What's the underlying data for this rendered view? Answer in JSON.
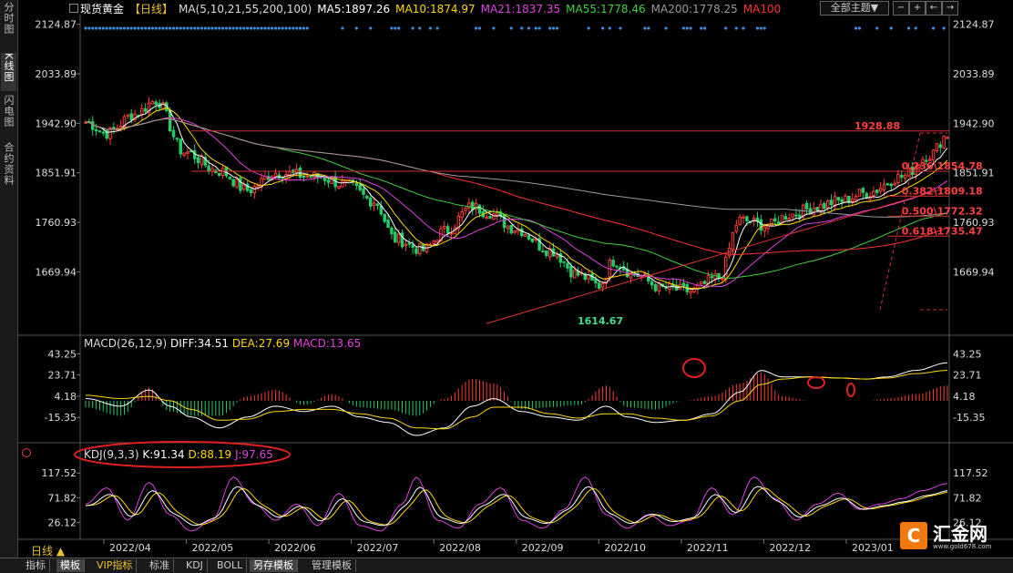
{
  "sidebar": {
    "tabs": [
      {
        "label": "分时图",
        "active": false
      },
      {
        "label": "K线图",
        "active": true
      },
      {
        "label": "闪电图",
        "active": false
      },
      {
        "label": "合约资料",
        "active": false
      }
    ]
  },
  "header": {
    "instrument": "现货黄金",
    "period": "【日线】",
    "ma_label": "MA(5,10,21,55,200,100)",
    "ma5": "MA5:1897.26",
    "ma10": "MA10:1874.97",
    "ma21": "MA21:1837.35",
    "ma55": "MA55:1778.46",
    "ma200": "MA200:1778.25",
    "ma100": "MA100",
    "theme_select": "全部主题▼"
  },
  "colors": {
    "up": "#ff3b3b",
    "down": "#22cc66",
    "ma5": "#ffffff",
    "ma10": "#ffd700",
    "ma21": "#e040e0",
    "ma55": "#40d040",
    "ma200": "#9a9a9a",
    "ma100": "#ff3030",
    "axis_text": "#dddddd",
    "annotation_red": "#ff4040",
    "low_label": "#44dd88"
  },
  "macd_title": {
    "label": "MACD(26,12,9)",
    "diff": "DIFF:34.51",
    "dea": "DEA:27.69",
    "macd": "MACD:13.65"
  },
  "kdj_title": {
    "label": "KDJ(9,3,3)",
    "k": "K:91.34",
    "d": "D:88.19",
    "j": "J:97.65"
  },
  "period_label": "日线 ▲",
  "bottom_tabs": [
    {
      "label": "指标",
      "active": false,
      "vip": false
    },
    {
      "label": "模板",
      "active": true,
      "vip": false
    },
    {
      "label": "VIP指标",
      "active": false,
      "vip": true
    },
    {
      "label": "标准",
      "active": false,
      "vip": false
    },
    {
      "label": "KDJ",
      "active": false,
      "vip": false
    },
    {
      "label": "BOLL",
      "active": false,
      "vip": false
    },
    {
      "label": "另存模板",
      "active": true,
      "vip": false
    },
    {
      "label": "管理模板",
      "active": false,
      "vip": false
    }
  ],
  "logo": {
    "mark": "C",
    "name": "汇金网",
    "url": "www.gold678.com"
  },
  "chart_data": [
    {
      "type": "candlestick",
      "title": "现货黄金 日线",
      "ylim": [
        1592,
        2136
      ],
      "yticks": [
        "2124.87",
        "2033.89",
        "1942.90",
        "1851.91",
        "1760.93",
        "1669.94"
      ],
      "ytick_values": [
        2124.87,
        2033.89,
        1942.9,
        1851.91,
        1760.93,
        1669.94
      ],
      "x_months": [
        "2022/04",
        "2022/05",
        "2022/06",
        "2022/07",
        "2022/08",
        "2022/09",
        "2022/10",
        "2022/11",
        "2022/12",
        "2023/01"
      ],
      "close_anchors": [
        [
          0,
          1945
        ],
        [
          6,
          1925
        ],
        [
          14,
          1960
        ],
        [
          20,
          1985
        ],
        [
          28,
          1890
        ],
        [
          38,
          1855
        ],
        [
          46,
          1820
        ],
        [
          54,
          1852
        ],
        [
          66,
          1845
        ],
        [
          74,
          1830
        ],
        [
          82,
          1800
        ],
        [
          88,
          1730
        ],
        [
          96,
          1710
        ],
        [
          102,
          1745
        ],
        [
          110,
          1790
        ],
        [
          114,
          1780
        ],
        [
          122,
          1750
        ],
        [
          132,
          1710
        ],
        [
          140,
          1665
        ],
        [
          146,
          1645
        ],
        [
          150,
          1690
        ],
        [
          156,
          1665
        ],
        [
          164,
          1640
        ],
        [
          172,
          1635
        ],
        [
          180,
          1660
        ],
        [
          186,
          1765
        ],
        [
          194,
          1755
        ],
        [
          200,
          1775
        ],
        [
          208,
          1790
        ],
        [
          214,
          1800
        ],
        [
          222,
          1815
        ],
        [
          232,
          1845
        ],
        [
          240,
          1885
        ],
        [
          245,
          1922
        ]
      ],
      "ma_end_values": {
        "ma5": 1897.26,
        "ma10": 1874.97,
        "ma21": 1837.35,
        "ma55": 1778.46,
        "ma200": 1778.25
      },
      "annotations": {
        "high_label": "1928.88",
        "low_label": "1614.67",
        "fib_levels": [
          {
            "label": "0.236\\1854.78",
            "value": 1854.78
          },
          {
            "label": "0.382\\1809.18",
            "value": 1809.18
          },
          {
            "label": "0.500\\1772.32",
            "value": 1772.32
          },
          {
            "label": "0.618\\1735.47",
            "value": 1735.47
          }
        ],
        "horizontal_lines": [
          1928.88,
          1854.78
        ],
        "trendline": [
          [
            0,
            1575
          ],
          [
            245,
            1825
          ]
        ]
      }
    },
    {
      "type": "macd",
      "title": "MACD(26,12,9)",
      "ylim": [
        -32,
        52
      ],
      "yticks": [
        "43.25",
        "23.71",
        "4.18",
        "-15.35"
      ],
      "ytick_values": [
        43.25,
        23.71,
        4.18,
        -15.35
      ],
      "diff_anchors": [
        [
          0,
          2
        ],
        [
          10,
          -5
        ],
        [
          18,
          10
        ],
        [
          24,
          -5
        ],
        [
          30,
          -15
        ],
        [
          38,
          -25
        ],
        [
          46,
          -15
        ],
        [
          54,
          -5
        ],
        [
          62,
          -10
        ],
        [
          70,
          -5
        ],
        [
          78,
          -15
        ],
        [
          86,
          -20
        ],
        [
          94,
          -32
        ],
        [
          102,
          -25
        ],
        [
          110,
          -5
        ],
        [
          116,
          2
        ],
        [
          124,
          -10
        ],
        [
          132,
          -15
        ],
        [
          140,
          -18
        ],
        [
          148,
          -5
        ],
        [
          154,
          -15
        ],
        [
          162,
          -20
        ],
        [
          170,
          -18
        ],
        [
          178,
          -12
        ],
        [
          186,
          8
        ],
        [
          192,
          28
        ],
        [
          198,
          22
        ],
        [
          206,
          22
        ],
        [
          214,
          21
        ],
        [
          222,
          20
        ],
        [
          228,
          22
        ],
        [
          236,
          28
        ],
        [
          245,
          35
        ]
      ],
      "dea_anchors": [
        [
          0,
          5
        ],
        [
          10,
          2
        ],
        [
          18,
          4
        ],
        [
          24,
          0
        ],
        [
          30,
          -8
        ],
        [
          38,
          -18
        ],
        [
          46,
          -17
        ],
        [
          54,
          -10
        ],
        [
          62,
          -8
        ],
        [
          70,
          -8
        ],
        [
          78,
          -12
        ],
        [
          86,
          -16
        ],
        [
          94,
          -25
        ],
        [
          102,
          -26
        ],
        [
          110,
          -15
        ],
        [
          116,
          -6
        ],
        [
          124,
          -6
        ],
        [
          132,
          -12
        ],
        [
          140,
          -16
        ],
        [
          148,
          -12
        ],
        [
          154,
          -12
        ],
        [
          162,
          -16
        ],
        [
          170,
          -18
        ],
        [
          178,
          -14
        ],
        [
          186,
          0
        ],
        [
          192,
          15
        ],
        [
          198,
          20
        ],
        [
          206,
          22
        ],
        [
          214,
          21
        ],
        [
          222,
          20
        ],
        [
          228,
          21
        ],
        [
          236,
          25
        ],
        [
          245,
          28
        ]
      ],
      "last": {
        "diff": 34.51,
        "dea": 27.69,
        "macd": 13.65
      }
    },
    {
      "type": "kdj",
      "title": "KDJ(9,3,3)",
      "ylim": [
        -2,
        150
      ],
      "yticks": [
        "117.52",
        "71.82",
        "26.12"
      ],
      "ytick_values": [
        117.52,
        71.82,
        26.12
      ],
      "j_anchors": [
        [
          0,
          60
        ],
        [
          6,
          90
        ],
        [
          12,
          30
        ],
        [
          18,
          100
        ],
        [
          24,
          40
        ],
        [
          30,
          10
        ],
        [
          36,
          30
        ],
        [
          42,
          110
        ],
        [
          48,
          60
        ],
        [
          54,
          30
        ],
        [
          60,
          60
        ],
        [
          66,
          20
        ],
        [
          72,
          80
        ],
        [
          78,
          20
        ],
        [
          84,
          10
        ],
        [
          90,
          60
        ],
        [
          94,
          110
        ],
        [
          100,
          30
        ],
        [
          106,
          15
        ],
        [
          112,
          60
        ],
        [
          118,
          90
        ],
        [
          124,
          30
        ],
        [
          130,
          15
        ],
        [
          136,
          50
        ],
        [
          142,
          110
        ],
        [
          148,
          40
        ],
        [
          154,
          15
        ],
        [
          160,
          40
        ],
        [
          166,
          20
        ],
        [
          172,
          30
        ],
        [
          178,
          90
        ],
        [
          184,
          40
        ],
        [
          190,
          110
        ],
        [
          196,
          70
        ],
        [
          202,
          30
        ],
        [
          208,
          60
        ],
        [
          214,
          80
        ],
        [
          220,
          50
        ],
        [
          226,
          60
        ],
        [
          232,
          70
        ],
        [
          238,
          85
        ],
        [
          245,
          98
        ]
      ],
      "last": {
        "k": 91.34,
        "d": 88.19,
        "j": 97.65
      }
    }
  ]
}
